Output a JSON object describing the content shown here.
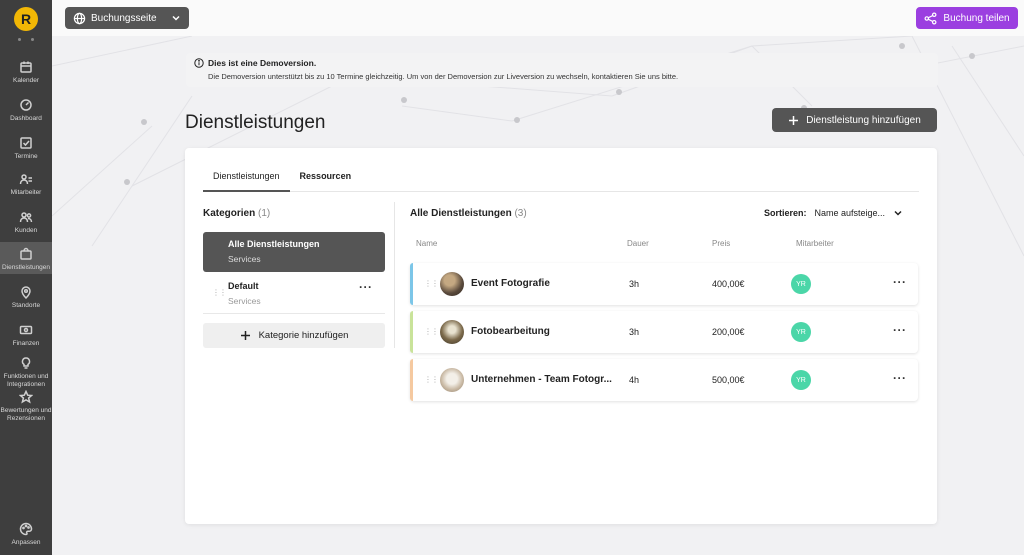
{
  "app": {
    "logo_letter": "R"
  },
  "sidebar": {
    "items": [
      {
        "label": "Kalender",
        "icon": "calendar-icon"
      },
      {
        "label": "Dashboard",
        "icon": "dashboard-icon"
      },
      {
        "label": "Termine",
        "icon": "checkbox-icon"
      },
      {
        "label": "Mitarbeiter",
        "icon": "staff-icon"
      },
      {
        "label": "Kunden",
        "icon": "users-icon"
      },
      {
        "label": "Dienstleistungen",
        "icon": "bag-icon",
        "active": true
      },
      {
        "label": "Standorte",
        "icon": "location-icon"
      },
      {
        "label": "Finanzen",
        "icon": "money-icon"
      },
      {
        "label": "Funktionen und Integrationen",
        "icon": "bulb-icon"
      },
      {
        "label": "Bewertungen und Rezensionen",
        "icon": "star-icon"
      }
    ],
    "bottom": {
      "label": "Anpassen",
      "icon": "palette-icon"
    }
  },
  "topbar": {
    "booking_select": "Buchungsseite",
    "share_button": "Buchung teilen"
  },
  "demo_banner": {
    "title": "Dies ist eine Demoversion.",
    "text": "Die Demoversion unterstützt bis zu 10 Termine gleichzeitig. Um von der Demoversion zur Liveversion zu wechseln, kontaktieren Sie uns bitte."
  },
  "page": {
    "title": "Dienstleistungen",
    "add_button": "Dienstleistung hinzufügen"
  },
  "tabs": [
    "Dienstleistungen",
    "Ressourcen"
  ],
  "categories": {
    "heading": "Kategorien",
    "count": "(1)",
    "items": [
      {
        "name": "Alle Dienstleistungen",
        "sub": "Services"
      },
      {
        "name": "Default",
        "sub": "Services"
      }
    ],
    "add_button": "Kategorie hinzufügen"
  },
  "services": {
    "heading": "Alle Dienstleistungen",
    "count": "(3)",
    "sort_label": "Sortieren:",
    "sort_value": "Name aufsteige...",
    "columns": {
      "name": "Name",
      "duration": "Dauer",
      "price": "Preis",
      "staff": "Mitarbeiter"
    },
    "rows": [
      {
        "name": "Event Fotografie",
        "duration": "3h",
        "price": "400,00€",
        "staff": "YR",
        "color": "#7cc6e8"
      },
      {
        "name": "Fotobearbeitung",
        "duration": "3h",
        "price": "200,00€",
        "staff": "YR",
        "color": "#c9e39a"
      },
      {
        "name": "Unternehmen - Team Fotogr...",
        "duration": "4h",
        "price": "500,00€",
        "staff": "YR",
        "color": "#f5c9a0"
      }
    ]
  },
  "colors": {
    "accent": "#9b3fe0",
    "sidebar": "#3e3e3e",
    "dark_button": "#555555",
    "staff_badge": "#4bd6a8"
  }
}
